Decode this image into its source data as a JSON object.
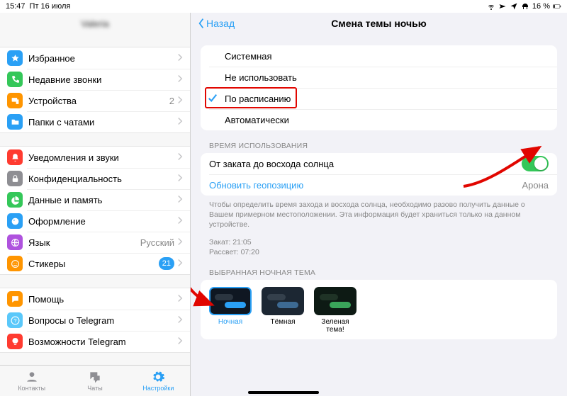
{
  "status": {
    "time": "15:47",
    "date": "Пт 16 июля",
    "battery": "16 %"
  },
  "sidebar": {
    "account_blur": "Valeria",
    "groups": [
      {
        "items": [
          {
            "icon": "star",
            "bg": "#2aa0f5",
            "label": "Избранное"
          },
          {
            "icon": "phone",
            "bg": "#34c759",
            "label": "Недавние звонки"
          },
          {
            "icon": "devices",
            "bg": "#ff9500",
            "label": "Устройства",
            "value": "2"
          },
          {
            "icon": "folder",
            "bg": "#2aa0f5",
            "label": "Папки с чатами"
          }
        ]
      },
      {
        "items": [
          {
            "icon": "bell",
            "bg": "#ff3b30",
            "label": "Уведомления и звуки"
          },
          {
            "icon": "lock",
            "bg": "#8e8e93",
            "label": "Конфиденциальность"
          },
          {
            "icon": "pie",
            "bg": "#34c759",
            "label": "Данные и память"
          },
          {
            "icon": "brush",
            "bg": "#2aa0f5",
            "label": "Оформление"
          },
          {
            "icon": "globe",
            "bg": "#af52de",
            "label": "Язык",
            "value": "Русский"
          },
          {
            "icon": "smile",
            "bg": "#ff9500",
            "label": "Стикеры",
            "badge": "21"
          }
        ]
      },
      {
        "items": [
          {
            "icon": "chat",
            "bg": "#ff9500",
            "label": "Помощь"
          },
          {
            "icon": "question",
            "bg": "#5ac8fa",
            "label": "Вопросы о Telegram"
          },
          {
            "icon": "bulb",
            "bg": "#ff3b30",
            "label": "Возможности Telegram"
          }
        ]
      }
    ]
  },
  "tabs": {
    "contacts": "Контакты",
    "chats": "Чаты",
    "settings": "Настройки"
  },
  "main": {
    "back": "Назад",
    "title": "Смена темы ночью",
    "mode_options": {
      "system": "Системная",
      "off": "Не использовать",
      "schedule": "По расписанию",
      "auto": "Автоматически"
    },
    "usage_header": "ВРЕМЯ ИСПОЛЬЗОВАНИЯ",
    "sunset_label": "От заката до восхода солнца",
    "geo": {
      "link": "Обновить геопозицию",
      "city": "Арона"
    },
    "note": "Чтобы определить время захода и восхода солнца, необходимо разово получить данные о Вашем примерном местоположении. Эта информация будет храниться только на данном устройстве.",
    "sunset": "Закат: 21:05",
    "sunrise": "Рассвет: 07:20",
    "themes_header": "ВЫБРАННАЯ НОЧНАЯ ТЕМА",
    "themes": {
      "night": "Ночная",
      "dark": "Тёмная",
      "green": "Зеленая тема!"
    }
  }
}
